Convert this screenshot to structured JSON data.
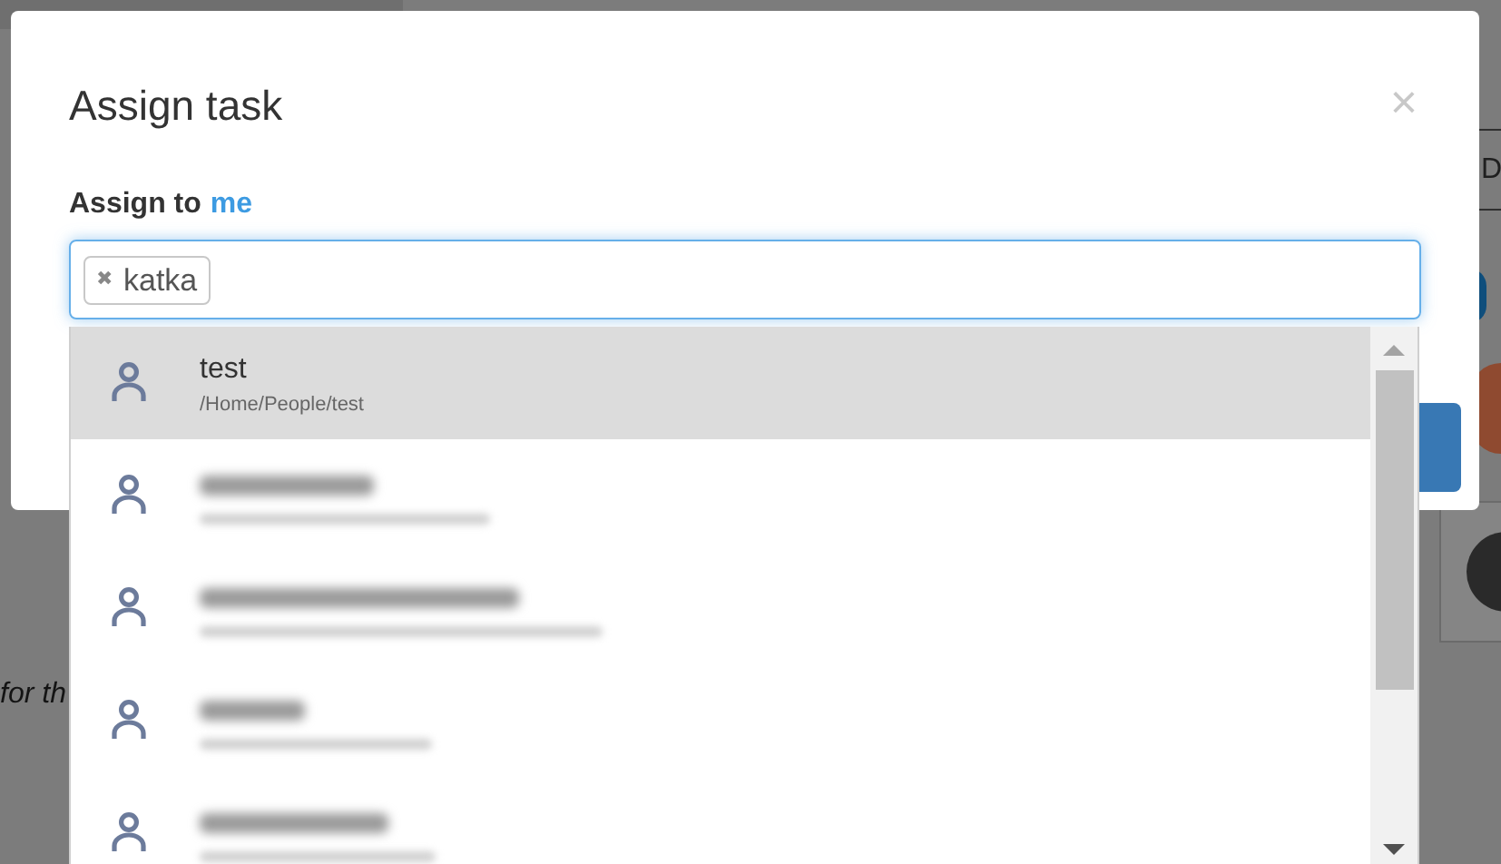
{
  "background": {
    "tab_fragment": "D",
    "text_fragment": "for th"
  },
  "dialog": {
    "title": "Assign task",
    "close": "×",
    "label": "Assign to",
    "label_link": "me",
    "field": {
      "chips": [
        {
          "remove": "✖",
          "label": "katka"
        }
      ]
    },
    "results": [
      {
        "kind": "person",
        "name": "test",
        "path": "/Home/People/test",
        "selected": true
      },
      {
        "kind": "redacted",
        "selected": false
      },
      {
        "kind": "redacted",
        "selected": false
      },
      {
        "kind": "redacted",
        "selected": false
      },
      {
        "kind": "redacted",
        "selected": false
      }
    ]
  }
}
